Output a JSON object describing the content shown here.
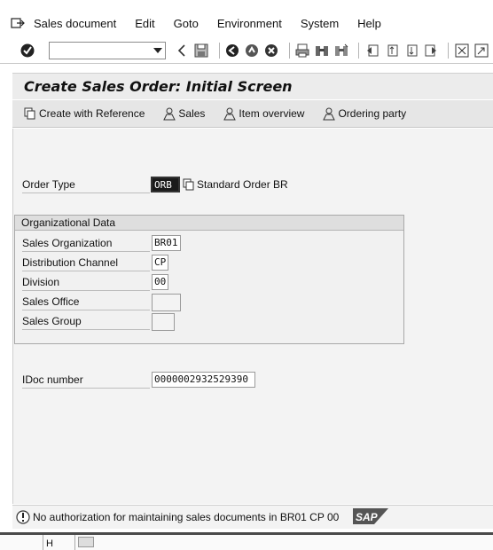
{
  "menubar": {
    "items": [
      {
        "label": "Sales document"
      },
      {
        "label": "Edit"
      },
      {
        "label": "Goto"
      },
      {
        "label": "Environment"
      },
      {
        "label": "System"
      },
      {
        "label": "Help"
      }
    ]
  },
  "toolbar": {
    "command_field_value": "",
    "icons": [
      "enter-icon",
      "save-icon",
      "back-icon",
      "exit-icon",
      "cancel-icon",
      "print-icon",
      "find-icon",
      "find-next-icon",
      "first-page-icon",
      "prev-page-icon",
      "next-page-icon",
      "last-page-icon",
      "create-session-icon",
      "shortcut-icon"
    ]
  },
  "title": "Create Sales Order: Initial Screen",
  "app_toolbar": {
    "buttons": [
      {
        "label": "Create with Reference",
        "icon": "copy-icon"
      },
      {
        "label": "Sales",
        "icon": "person-icon"
      },
      {
        "label": "Item overview",
        "icon": "person-icon"
      },
      {
        "label": "Ordering party",
        "icon": "person-icon"
      }
    ]
  },
  "order_type": {
    "label": "Order Type",
    "value": "ORB",
    "description": "Standard Order BR"
  },
  "org_data": {
    "title": "Organizational Data",
    "fields": [
      {
        "label": "Sales Organization",
        "value": "BR01"
      },
      {
        "label": "Distribution Channel",
        "value": "CP"
      },
      {
        "label": "Division",
        "value": "00"
      },
      {
        "label": "Sales Office",
        "value": ""
      },
      {
        "label": "Sales Group",
        "value": ""
      }
    ]
  },
  "idoc": {
    "label": "IDoc number",
    "value": "0000002932529390"
  },
  "status": {
    "message": "No authorization for maintaining sales documents in BR01 CP 00",
    "type": "warning",
    "logo": "SAP"
  },
  "bottom": {
    "text": "H"
  }
}
